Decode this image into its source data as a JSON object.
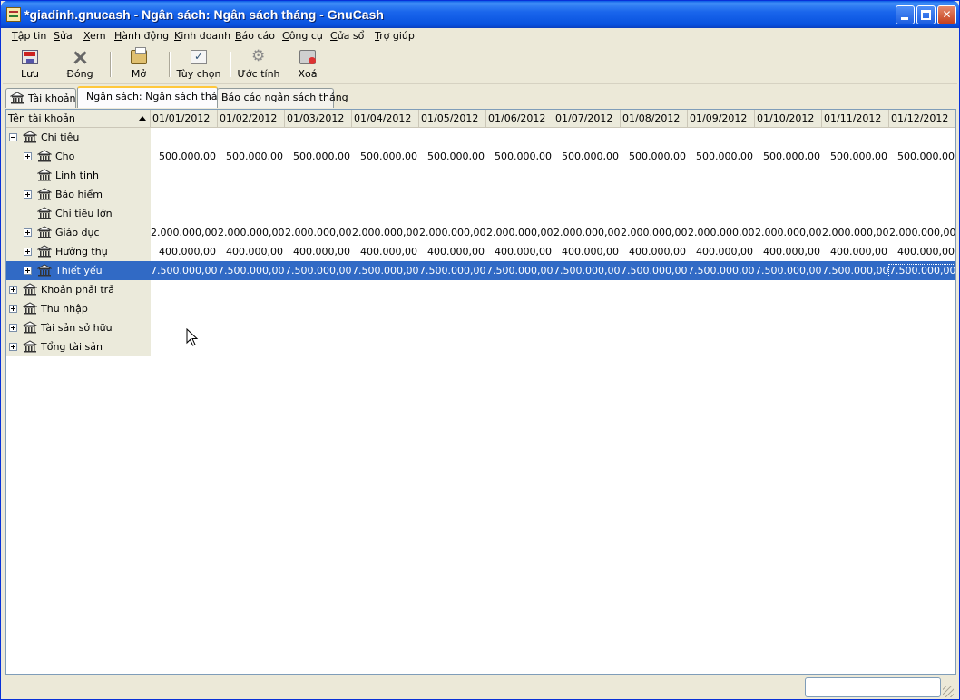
{
  "window": {
    "title": "*giadinh.gnucash - Ngân sách: Ngân sách tháng - GnuCash",
    "controls": [
      "minimize",
      "maximize",
      "close"
    ]
  },
  "menu": [
    {
      "label": "Tập tin",
      "mnemonic": "T",
      "rest": "ập tin"
    },
    {
      "label": "Sửa",
      "mnemonic": "S",
      "rest": "ửa"
    },
    {
      "label": "Xem",
      "mnemonic": "X",
      "rest": "em"
    },
    {
      "label": "Hành động",
      "mnemonic": "H",
      "rest": "ành động"
    },
    {
      "label": "Kinh doanh",
      "mnemonic": "K",
      "rest": "inh doanh"
    },
    {
      "label": "Báo cáo",
      "mnemonic": "B",
      "rest": "áo cáo"
    },
    {
      "label": "Công cụ",
      "mnemonic": "C",
      "rest": "ông cụ"
    },
    {
      "label": "Cửa sổ",
      "mnemonic": "C",
      "rest": "ửa sổ"
    },
    {
      "label": "Trợ giúp",
      "mnemonic": "T",
      "rest": "rợ giúp"
    }
  ],
  "toolbar": {
    "save": "Lưu",
    "close": "Đóng",
    "open": "Mở",
    "options": "Tùy chọn",
    "estimate": "Ước tính",
    "delete": "Xoá"
  },
  "tabs": [
    {
      "label": "Tài khoản",
      "icon": "bank-icon",
      "active": false
    },
    {
      "label": "Ngân sách: Ngân sách tháng",
      "active": true
    },
    {
      "label": "Báo cáo ngân sách tháng",
      "active": false
    }
  ],
  "table": {
    "name_header": "Tên tài khoản",
    "sort_icon": "sort-ascending-icon",
    "months": [
      "01/01/2012",
      "01/02/2012",
      "01/03/2012",
      "01/04/2012",
      "01/05/2012",
      "01/06/2012",
      "01/07/2012",
      "01/08/2012",
      "01/09/2012",
      "01/10/2012",
      "01/11/2012",
      "01/12/2012"
    ],
    "rows": [
      {
        "name": "Chi tiêu",
        "level": 0,
        "expander": "minus",
        "values": []
      },
      {
        "name": "Cho",
        "level": 1,
        "expander": "plus",
        "values": [
          "500.000,00",
          "500.000,00",
          "500.000,00",
          "500.000,00",
          "500.000,00",
          "500.000,00",
          "500.000,00",
          "500.000,00",
          "500.000,00",
          "500.000,00",
          "500.000,00",
          "500.000,00"
        ]
      },
      {
        "name": "Linh tinh",
        "level": 1,
        "expander": "none",
        "values": []
      },
      {
        "name": "Bảo hiểm",
        "level": 1,
        "expander": "plus",
        "values": []
      },
      {
        "name": "Chi tiêu lớn",
        "level": 1,
        "expander": "none",
        "values": []
      },
      {
        "name": "Giáo dục",
        "level": 1,
        "expander": "plus",
        "values": [
          "2.000.000,00",
          "2.000.000,00",
          "2.000.000,00",
          "2.000.000,00",
          "2.000.000,00",
          "2.000.000,00",
          "2.000.000,00",
          "2.000.000,00",
          "2.000.000,00",
          "2.000.000,00",
          "2.000.000,00",
          "2.000.000,00"
        ]
      },
      {
        "name": "Hưởng thụ",
        "level": 1,
        "expander": "plus",
        "values": [
          "400.000,00",
          "400.000,00",
          "400.000,00",
          "400.000,00",
          "400.000,00",
          "400.000,00",
          "400.000,00",
          "400.000,00",
          "400.000,00",
          "400.000,00",
          "400.000,00",
          "400.000,00"
        ]
      },
      {
        "name": "Thiết yếu",
        "level": 1,
        "expander": "plus",
        "selected": true,
        "values": [
          "7.500.000,00",
          "7.500.000,00",
          "7.500.000,00",
          "7.500.000,00",
          "7.500.000,00",
          "7.500.000,00",
          "7.500.000,00",
          "7.500.000,00",
          "7.500.000,00",
          "7.500.000,00",
          "7.500.000,00",
          "7.500.000,00"
        ]
      },
      {
        "name": "Khoản phải trả",
        "level": 0,
        "expander": "plus",
        "values": []
      },
      {
        "name": "Thu nhập",
        "level": 0,
        "expander": "plus",
        "values": []
      },
      {
        "name": "Tài sản sở hữu",
        "level": 0,
        "expander": "plus",
        "values": []
      },
      {
        "name": "Tổng tài sản",
        "level": 0,
        "expander": "plus",
        "values": []
      }
    ]
  },
  "colors": {
    "selection": "#316ac5",
    "titlebar": "#0a5ce6",
    "chrome": "#ece9d8"
  }
}
